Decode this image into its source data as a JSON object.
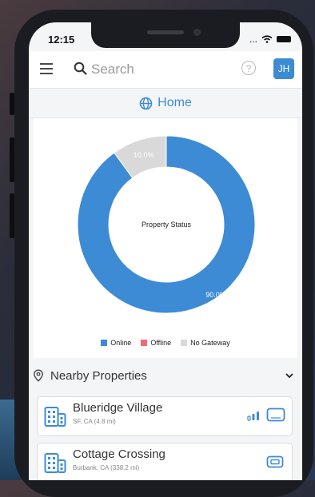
{
  "status_bar": {
    "time": "12:15",
    "right": "..."
  },
  "header": {
    "search_placeholder": "Search",
    "help_glyph": "?",
    "avatar_initials": "JH"
  },
  "home": {
    "label": "Home"
  },
  "chart_data": {
    "type": "pie",
    "title": "Property Status",
    "categories": [
      "Online",
      "Offline",
      "No Gateway"
    ],
    "values": [
      90.0,
      0.0,
      10.0
    ],
    "value_labels": [
      "90.0%",
      "",
      "10.0%"
    ],
    "colors": [
      "#3d8bd4",
      "#f06b7a",
      "#d9d9d9"
    ],
    "legend": "bottom"
  },
  "nearby": {
    "title": "Nearby Properties",
    "properties": [
      {
        "name": "Blueridge Village",
        "city": "SF, CA",
        "distance": "(4.8 mi)"
      },
      {
        "name": "Cottage Crossing",
        "city": "Burbank, CA",
        "distance": "(338.2 mi)"
      }
    ]
  },
  "colors": {
    "accent": "#3d8bd4",
    "background": "#f4f5f7"
  }
}
